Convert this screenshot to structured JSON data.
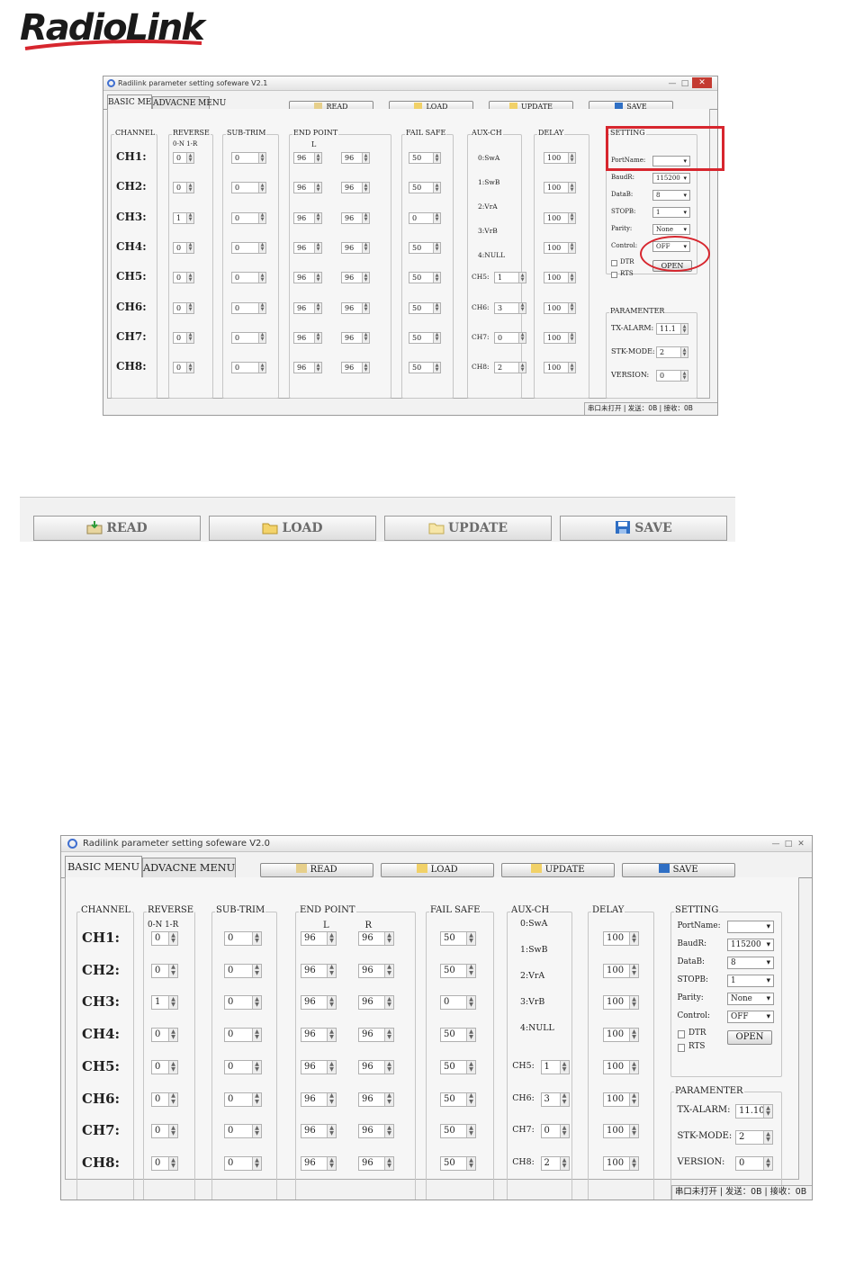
{
  "brand": {
    "logo_text": "RadioLink"
  },
  "window1": {
    "title": "Radilink parameter setting sofeware V2.1",
    "tabs": [
      "BASIC MENU",
      "ADVACNE MENU"
    ],
    "buttons": {
      "read": "READ",
      "load": "LOAD",
      "update": "UPDATE",
      "save": "SAVE"
    },
    "headers": {
      "channel": "CHANNEL",
      "reverse": "REVERSE",
      "subtrim": "SUB-TRIM",
      "endpoint": "END POINT",
      "failsafe": "FAIL SAFE",
      "auxch": "AUX-CH",
      "delay": "DELAY",
      "setting": "SETTING"
    },
    "reverse_sub": "0-N  1-R",
    "endpoint_sub_l": "L",
    "endpoint_sub_r": "",
    "channels": [
      "CH1:",
      "CH2:",
      "CH3:",
      "CH4:",
      "CH5:",
      "CH6:",
      "CH7:",
      "CH8:"
    ],
    "reverse": [
      "0",
      "0",
      "1",
      "0",
      "0",
      "0",
      "0",
      "0"
    ],
    "subtrim": [
      "0",
      "0",
      "0",
      "0",
      "0",
      "0",
      "0",
      "0"
    ],
    "ep_l": [
      "96",
      "96",
      "96",
      "96",
      "96",
      "96",
      "96",
      "96"
    ],
    "ep_r": [
      "96",
      "96",
      "96",
      "96",
      "96",
      "96",
      "96",
      "96"
    ],
    "failsafe": [
      "50",
      "50",
      "0",
      "50",
      "50",
      "50",
      "50",
      "50"
    ],
    "aux_labels": [
      "0:SwA",
      "1:SwB",
      "2:VrA",
      "3:VrB",
      "4:NULL"
    ],
    "aux_rows": [
      {
        "label": "CH5:",
        "value": "1"
      },
      {
        "label": "CH6:",
        "value": "3"
      },
      {
        "label": "CH7:",
        "value": "0"
      },
      {
        "label": "CH8:",
        "value": "2"
      }
    ],
    "delay": [
      "100",
      "100",
      "100",
      "100",
      "100",
      "100",
      "100",
      "100"
    ],
    "setting": {
      "portname_label": "PortName:",
      "portname_value": "",
      "baudrate_label": "BaudR:",
      "baudrate_value": "115200",
      "datab_label": "DataB:",
      "datab_value": "8",
      "stopb_label": "STOPB:",
      "stopb_value": "1",
      "parity_label": "Parity:",
      "parity_value": "None",
      "control_label": "Control:",
      "control_value": "OFF",
      "dtr_label": "DTR",
      "rts_label": "RTS",
      "open_button": "OPEN"
    },
    "parameter": {
      "title": "PARAMENTER",
      "tx_alarm_label": "TX-ALARM:",
      "tx_alarm_value": "11.1",
      "stk_mode_label": "STK-MODE:",
      "stk_mode_value": "2",
      "version_label": "VERSION:",
      "version_value": "0"
    },
    "status": "串口未打开 | 发送：0B | 接收：0B"
  },
  "strip": {
    "read": "READ",
    "load": "LOAD",
    "update": "UPDATE",
    "save": "SAVE"
  },
  "window2": {
    "title": "Radilink parameter setting sofeware V2.0",
    "tabs": [
      "BASIC MENU",
      "ADVACNE MENU"
    ],
    "buttons": {
      "read": "READ",
      "load": "LOAD",
      "update": "UPDATE",
      "save": "SAVE"
    },
    "headers": {
      "channel": "CHANNEL",
      "reverse": "REVERSE",
      "subtrim": "SUB-TRIM",
      "endpoint": "END POINT",
      "failsafe": "FAIL SAFE",
      "auxch": "AUX-CH",
      "delay": "DELAY",
      "setting": "SETTING"
    },
    "reverse_sub": "0-N  1-R",
    "endpoint_sub_l": "L",
    "endpoint_sub_r": "R",
    "channels": [
      "CH1:",
      "CH2:",
      "CH3:",
      "CH4:",
      "CH5:",
      "CH6:",
      "CH7:",
      "CH8:"
    ],
    "reverse": [
      "0",
      "0",
      "1",
      "0",
      "0",
      "0",
      "0",
      "0"
    ],
    "subtrim": [
      "0",
      "0",
      "0",
      "0",
      "0",
      "0",
      "0",
      "0"
    ],
    "ep_l": [
      "96",
      "96",
      "96",
      "96",
      "96",
      "96",
      "96",
      "96"
    ],
    "ep_r": [
      "96",
      "96",
      "96",
      "96",
      "96",
      "96",
      "96",
      "96"
    ],
    "failsafe": [
      "50",
      "50",
      "0",
      "50",
      "50",
      "50",
      "50",
      "50"
    ],
    "aux_labels": [
      "0:SwA",
      "1:SwB",
      "2:VrA",
      "3:VrB",
      "4:NULL"
    ],
    "aux_rows": [
      {
        "label": "CH5:",
        "value": "1"
      },
      {
        "label": "CH6:",
        "value": "3"
      },
      {
        "label": "CH7:",
        "value": "0"
      },
      {
        "label": "CH8:",
        "value": "2"
      }
    ],
    "delay": [
      "100",
      "100",
      "100",
      "100",
      "100",
      "100",
      "100",
      "100"
    ],
    "setting": {
      "portname_label": "PortName:",
      "portname_value": "",
      "baudrate_label": "BaudR:",
      "baudrate_value": "115200",
      "datab_label": "DataB:",
      "datab_value": "8",
      "stopb_label": "STOPB:",
      "stopb_value": "1",
      "parity_label": "Parity:",
      "parity_value": "None",
      "control_label": "Control:",
      "control_value": "OFF",
      "dtr_label": "DTR",
      "rts_label": "RTS",
      "open_button": "OPEN"
    },
    "parameter": {
      "title": "PARAMENTER",
      "tx_alarm_label": "TX-ALARM:",
      "tx_alarm_value": "11.10",
      "stk_mode_label": "STK-MODE:",
      "stk_mode_value": "2",
      "version_label": "VERSION:",
      "version_value": "0"
    },
    "status": "串口未打开 | 发送：0B | 接收：0B"
  },
  "colors": {
    "highlight": "#d7262e",
    "window_bg": "#f2f2f2"
  }
}
